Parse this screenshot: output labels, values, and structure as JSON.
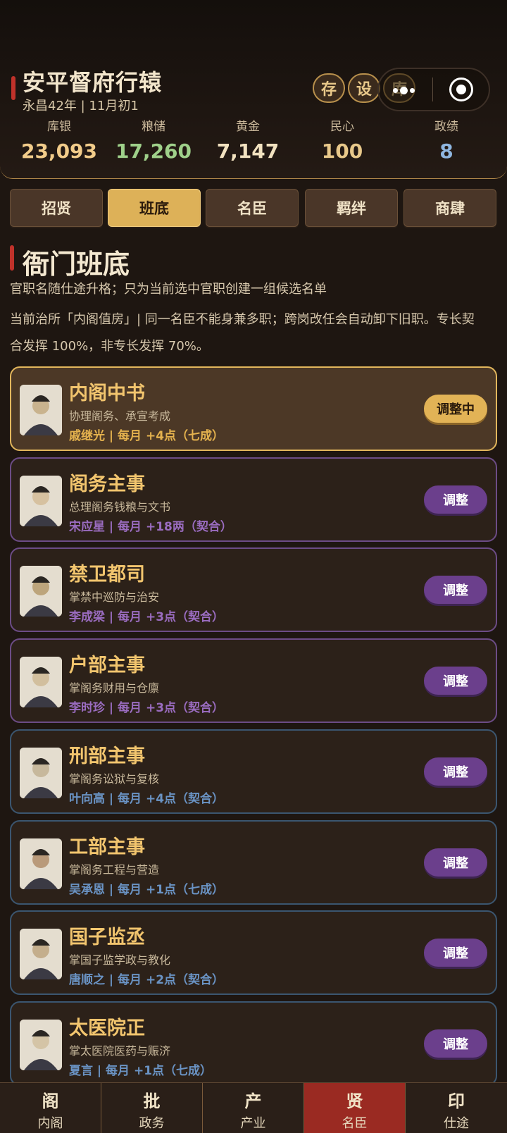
{
  "header": {
    "city_title": "安平督府行辕",
    "date": "永昌42年 | 11月初1",
    "buttons": [
      "存",
      "设",
      "库"
    ],
    "stats": [
      {
        "label": "库银",
        "value": "23,093",
        "color": "#f2cc8a"
      },
      {
        "label": "粮储",
        "value": "17,260",
        "color": "#9fd08a"
      },
      {
        "label": "黄金",
        "value": "7,147",
        "color": "#f2e2c0"
      },
      {
        "label": "民心",
        "value": "100",
        "color": "#e8c88a"
      },
      {
        "label": "政绩",
        "value": "8",
        "color": "#8fb6e0"
      }
    ]
  },
  "tabs": [
    "招贤",
    "班底",
    "名臣",
    "羁绊",
    "商肆"
  ],
  "active_tab": "班底",
  "section": {
    "title": "衙门班底",
    "desc1": "官职名随仕途升格；只为当前选中官职创建一组候选名单",
    "desc2": "当前治所「内阁值房」| 同一名臣不能身兼多职；跨岗改任会自动卸下旧职。专长契",
    "desc3": "合发挥 100%，非专长发挥 70%。"
  },
  "posts": [
    {
      "title": "内阁中书",
      "duty": "协理阁务、承宣考成",
      "officer": "戚继光 | 每月 +4点（七成）",
      "button": "调整中",
      "style": "sel",
      "officer_color": "#e4b24e"
    },
    {
      "title": "阁务主事",
      "duty": "总理阁务钱粮与文书",
      "officer": "宋应星 | 每月 +18两（契合）",
      "button": "调整",
      "style": "purple",
      "officer_color": "#9a6cc0"
    },
    {
      "title": "禁卫都司",
      "duty": "掌禁中巡防与治安",
      "officer": "李成梁 | 每月 +3点（契合）",
      "button": "调整",
      "style": "purple",
      "officer_color": "#9a6cc0"
    },
    {
      "title": "户部主事",
      "duty": "掌阁务财用与仓廪",
      "officer": "李时珍 | 每月 +3点（契合）",
      "button": "调整",
      "style": "purple",
      "officer_color": "#9a6cc0"
    },
    {
      "title": "刑部主事",
      "duty": "掌阁务讼狱与复核",
      "officer": "叶向高 | 每月 +4点（契合）",
      "button": "调整",
      "style": "blue",
      "officer_color": "#6a93c4"
    },
    {
      "title": "工部主事",
      "duty": "掌阁务工程与营造",
      "officer": "吴承恩 | 每月 +1点（七成）",
      "button": "调整",
      "style": "blue",
      "officer_color": "#6a93c4"
    },
    {
      "title": "国子监丞",
      "duty": "掌国子监学政与教化",
      "officer": "唐顺之 | 每月 +2点（契合）",
      "button": "调整",
      "style": "blue",
      "officer_color": "#6a93c4"
    },
    {
      "title": "太医院正",
      "duty": "掌太医院医药与赈济",
      "officer": "夏言 | 每月 +1点（七成）",
      "button": "调整",
      "style": "blue",
      "officer_color": "#6a93c4"
    }
  ],
  "bottom_nav": [
    {
      "icon": "阁",
      "label": "内阁"
    },
    {
      "icon": "批",
      "label": "政务"
    },
    {
      "icon": "产",
      "label": "产业"
    },
    {
      "icon": "贤",
      "label": "名臣"
    },
    {
      "icon": "印",
      "label": "仕途"
    }
  ],
  "active_nav": "名臣"
}
